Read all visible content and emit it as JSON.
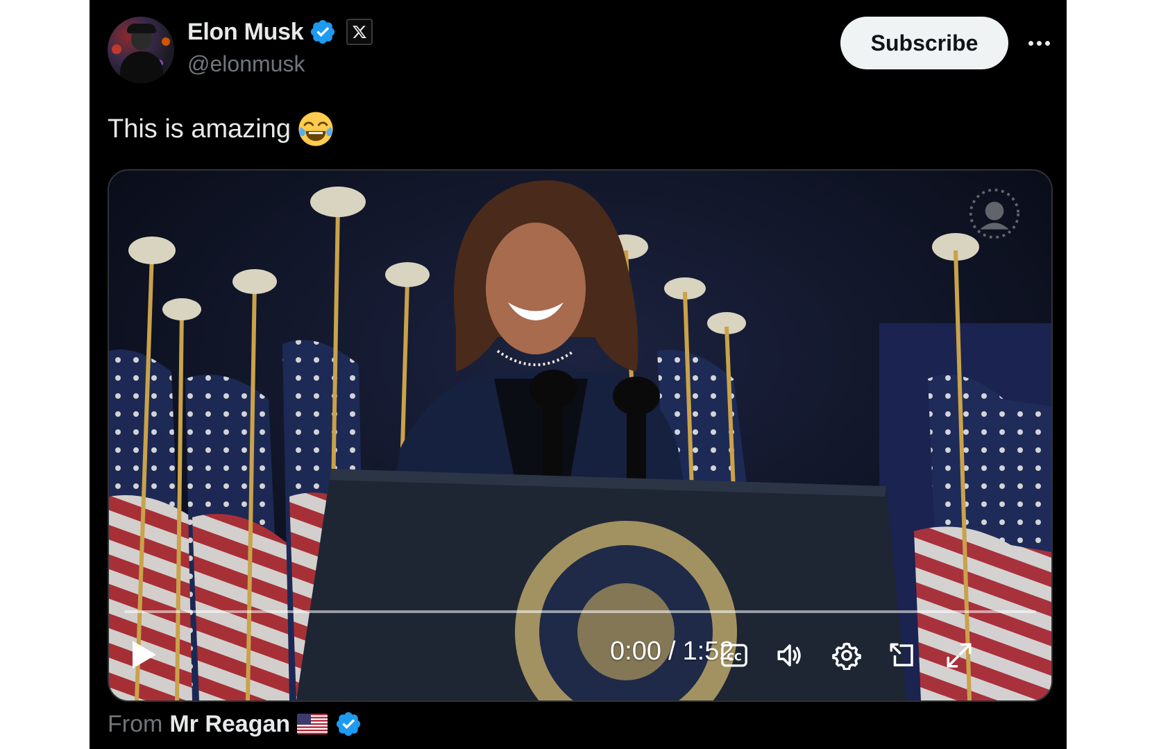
{
  "post": {
    "author_name": "Elon Musk",
    "handle": "@elonmusk",
    "subscribe_label": "Subscribe",
    "text": "This is amazing",
    "text_emoji": "face-with-tears-of-joy"
  },
  "video": {
    "current_time": "0:00",
    "separator": "/",
    "duration": "1:52",
    "progress": 0,
    "controls": [
      "play-icon",
      "cc-icon",
      "volume-icon",
      "settings-icon",
      "pop-out-icon",
      "fullscreen-icon"
    ]
  },
  "attribution": {
    "from_label": "From",
    "source_name": "Mr Reagan",
    "flag": "us-flag"
  },
  "colors": {
    "background": "#000000",
    "verified": "#1d9bf0",
    "text_primary": "#e7e9ea",
    "text_secondary": "#71767b",
    "subscribe_bg": "#eff3f4"
  }
}
